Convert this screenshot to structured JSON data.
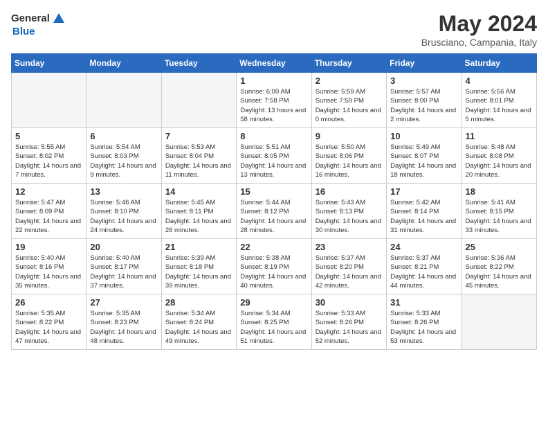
{
  "logo": {
    "text_general": "General",
    "text_blue": "Blue"
  },
  "header": {
    "month_title": "May 2024",
    "location": "Brusciano, Campania, Italy"
  },
  "days_of_week": [
    "Sunday",
    "Monday",
    "Tuesday",
    "Wednesday",
    "Thursday",
    "Friday",
    "Saturday"
  ],
  "weeks": [
    [
      {
        "day": "",
        "empty": true
      },
      {
        "day": "",
        "empty": true
      },
      {
        "day": "",
        "empty": true
      },
      {
        "day": "1",
        "sunrise": "Sunrise: 6:00 AM",
        "sunset": "Sunset: 7:58 PM",
        "daylight": "Daylight: 13 hours and 58 minutes."
      },
      {
        "day": "2",
        "sunrise": "Sunrise: 5:59 AM",
        "sunset": "Sunset: 7:59 PM",
        "daylight": "Daylight: 14 hours and 0 minutes."
      },
      {
        "day": "3",
        "sunrise": "Sunrise: 5:57 AM",
        "sunset": "Sunset: 8:00 PM",
        "daylight": "Daylight: 14 hours and 2 minutes."
      },
      {
        "day": "4",
        "sunrise": "Sunrise: 5:56 AM",
        "sunset": "Sunset: 8:01 PM",
        "daylight": "Daylight: 14 hours and 5 minutes."
      }
    ],
    [
      {
        "day": "5",
        "sunrise": "Sunrise: 5:55 AM",
        "sunset": "Sunset: 8:02 PM",
        "daylight": "Daylight: 14 hours and 7 minutes."
      },
      {
        "day": "6",
        "sunrise": "Sunrise: 5:54 AM",
        "sunset": "Sunset: 8:03 PM",
        "daylight": "Daylight: 14 hours and 9 minutes."
      },
      {
        "day": "7",
        "sunrise": "Sunrise: 5:53 AM",
        "sunset": "Sunset: 8:04 PM",
        "daylight": "Daylight: 14 hours and 11 minutes."
      },
      {
        "day": "8",
        "sunrise": "Sunrise: 5:51 AM",
        "sunset": "Sunset: 8:05 PM",
        "daylight": "Daylight: 14 hours and 13 minutes."
      },
      {
        "day": "9",
        "sunrise": "Sunrise: 5:50 AM",
        "sunset": "Sunset: 8:06 PM",
        "daylight": "Daylight: 14 hours and 16 minutes."
      },
      {
        "day": "10",
        "sunrise": "Sunrise: 5:49 AM",
        "sunset": "Sunset: 8:07 PM",
        "daylight": "Daylight: 14 hours and 18 minutes."
      },
      {
        "day": "11",
        "sunrise": "Sunrise: 5:48 AM",
        "sunset": "Sunset: 8:08 PM",
        "daylight": "Daylight: 14 hours and 20 minutes."
      }
    ],
    [
      {
        "day": "12",
        "sunrise": "Sunrise: 5:47 AM",
        "sunset": "Sunset: 8:09 PM",
        "daylight": "Daylight: 14 hours and 22 minutes."
      },
      {
        "day": "13",
        "sunrise": "Sunrise: 5:46 AM",
        "sunset": "Sunset: 8:10 PM",
        "daylight": "Daylight: 14 hours and 24 minutes."
      },
      {
        "day": "14",
        "sunrise": "Sunrise: 5:45 AM",
        "sunset": "Sunset: 8:11 PM",
        "daylight": "Daylight: 14 hours and 26 minutes."
      },
      {
        "day": "15",
        "sunrise": "Sunrise: 5:44 AM",
        "sunset": "Sunset: 8:12 PM",
        "daylight": "Daylight: 14 hours and 28 minutes."
      },
      {
        "day": "16",
        "sunrise": "Sunrise: 5:43 AM",
        "sunset": "Sunset: 8:13 PM",
        "daylight": "Daylight: 14 hours and 30 minutes."
      },
      {
        "day": "17",
        "sunrise": "Sunrise: 5:42 AM",
        "sunset": "Sunset: 8:14 PM",
        "daylight": "Daylight: 14 hours and 31 minutes."
      },
      {
        "day": "18",
        "sunrise": "Sunrise: 5:41 AM",
        "sunset": "Sunset: 8:15 PM",
        "daylight": "Daylight: 14 hours and 33 minutes."
      }
    ],
    [
      {
        "day": "19",
        "sunrise": "Sunrise: 5:40 AM",
        "sunset": "Sunset: 8:16 PM",
        "daylight": "Daylight: 14 hours and 35 minutes."
      },
      {
        "day": "20",
        "sunrise": "Sunrise: 5:40 AM",
        "sunset": "Sunset: 8:17 PM",
        "daylight": "Daylight: 14 hours and 37 minutes."
      },
      {
        "day": "21",
        "sunrise": "Sunrise: 5:39 AM",
        "sunset": "Sunset: 8:18 PM",
        "daylight": "Daylight: 14 hours and 39 minutes."
      },
      {
        "day": "22",
        "sunrise": "Sunrise: 5:38 AM",
        "sunset": "Sunset: 8:19 PM",
        "daylight": "Daylight: 14 hours and 40 minutes."
      },
      {
        "day": "23",
        "sunrise": "Sunrise: 5:37 AM",
        "sunset": "Sunset: 8:20 PM",
        "daylight": "Daylight: 14 hours and 42 minutes."
      },
      {
        "day": "24",
        "sunrise": "Sunrise: 5:37 AM",
        "sunset": "Sunset: 8:21 PM",
        "daylight": "Daylight: 14 hours and 44 minutes."
      },
      {
        "day": "25",
        "sunrise": "Sunrise: 5:36 AM",
        "sunset": "Sunset: 8:22 PM",
        "daylight": "Daylight: 14 hours and 45 minutes."
      }
    ],
    [
      {
        "day": "26",
        "sunrise": "Sunrise: 5:35 AM",
        "sunset": "Sunset: 8:22 PM",
        "daylight": "Daylight: 14 hours and 47 minutes."
      },
      {
        "day": "27",
        "sunrise": "Sunrise: 5:35 AM",
        "sunset": "Sunset: 8:23 PM",
        "daylight": "Daylight: 14 hours and 48 minutes."
      },
      {
        "day": "28",
        "sunrise": "Sunrise: 5:34 AM",
        "sunset": "Sunset: 8:24 PM",
        "daylight": "Daylight: 14 hours and 49 minutes."
      },
      {
        "day": "29",
        "sunrise": "Sunrise: 5:34 AM",
        "sunset": "Sunset: 8:25 PM",
        "daylight": "Daylight: 14 hours and 51 minutes."
      },
      {
        "day": "30",
        "sunrise": "Sunrise: 5:33 AM",
        "sunset": "Sunset: 8:26 PM",
        "daylight": "Daylight: 14 hours and 52 minutes."
      },
      {
        "day": "31",
        "sunrise": "Sunrise: 5:33 AM",
        "sunset": "Sunset: 8:26 PM",
        "daylight": "Daylight: 14 hours and 53 minutes."
      },
      {
        "day": "",
        "empty": true
      }
    ]
  ]
}
